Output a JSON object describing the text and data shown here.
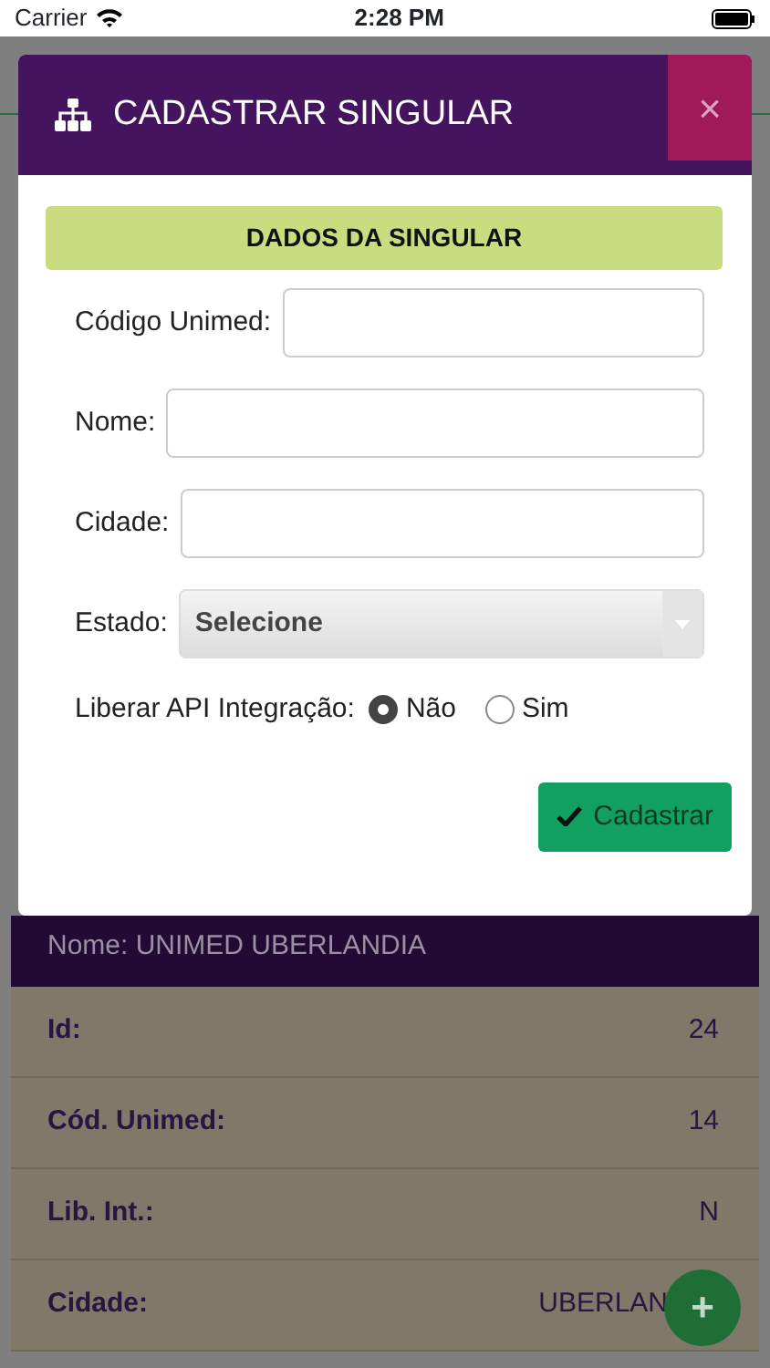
{
  "status_bar": {
    "carrier": "Carrier",
    "time": "2:28 PM"
  },
  "modal": {
    "title": "CADASTRAR SINGULAR",
    "close": "×",
    "section": "DADOS DA SINGULAR",
    "fields": [
      {
        "kind": "text",
        "label": "Código Unimed:"
      },
      {
        "kind": "text",
        "label": "Nome:"
      },
      {
        "kind": "text",
        "label": "Cidade:"
      },
      {
        "kind": "select",
        "label": "Estado:",
        "value": "Selecione"
      }
    ],
    "radio_group": {
      "label": "Liberar API Integração:",
      "options": [
        {
          "label": "Não",
          "selected": true
        },
        {
          "label": "Sim",
          "selected": false
        }
      ]
    },
    "submit": "Cadastrar"
  },
  "background_card": {
    "header": "Nome: UNIMED UBERLANDIA",
    "rows": [
      {
        "label": "Id:",
        "value": "24"
      },
      {
        "label": "Cód. Unimed:",
        "value": "14"
      },
      {
        "label": "Lib. Int.:",
        "value": "N"
      },
      {
        "label": "Cidade:",
        "value": "UBERLAN"
      }
    ]
  },
  "fab": "+"
}
